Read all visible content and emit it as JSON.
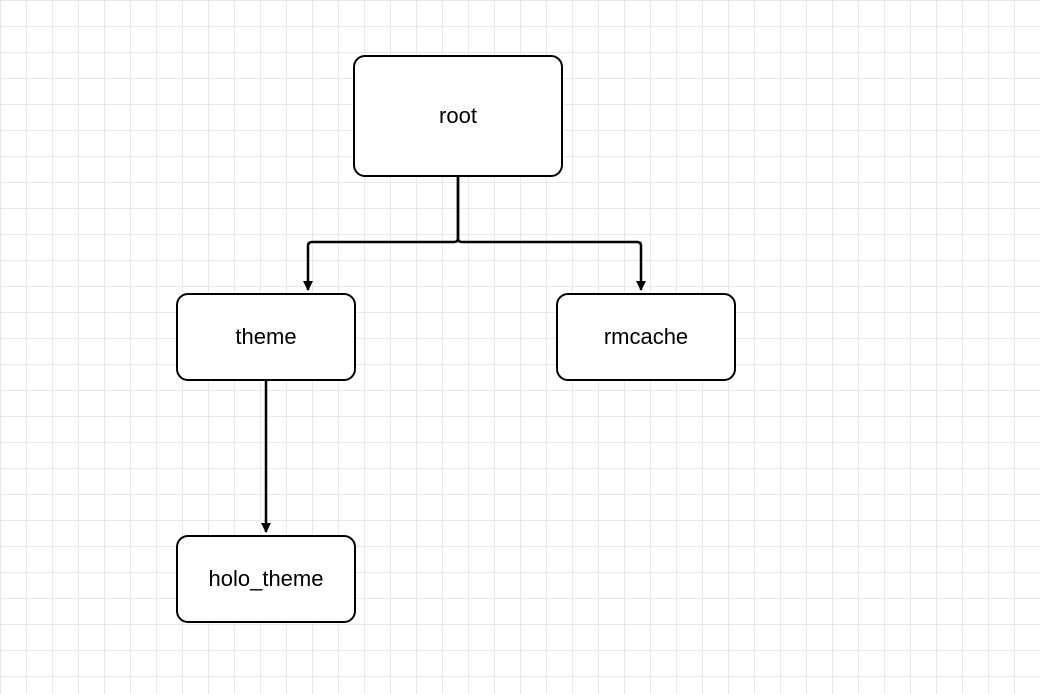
{
  "diagram": {
    "nodes": {
      "root": {
        "label": "root"
      },
      "theme": {
        "label": "theme"
      },
      "rmcache": {
        "label": "rmcache"
      },
      "holo_theme": {
        "label": "holo_theme"
      }
    },
    "edges": [
      {
        "from": "root",
        "to": "theme"
      },
      {
        "from": "root",
        "to": "rmcache"
      },
      {
        "from": "theme",
        "to": "holo_theme"
      }
    ]
  }
}
